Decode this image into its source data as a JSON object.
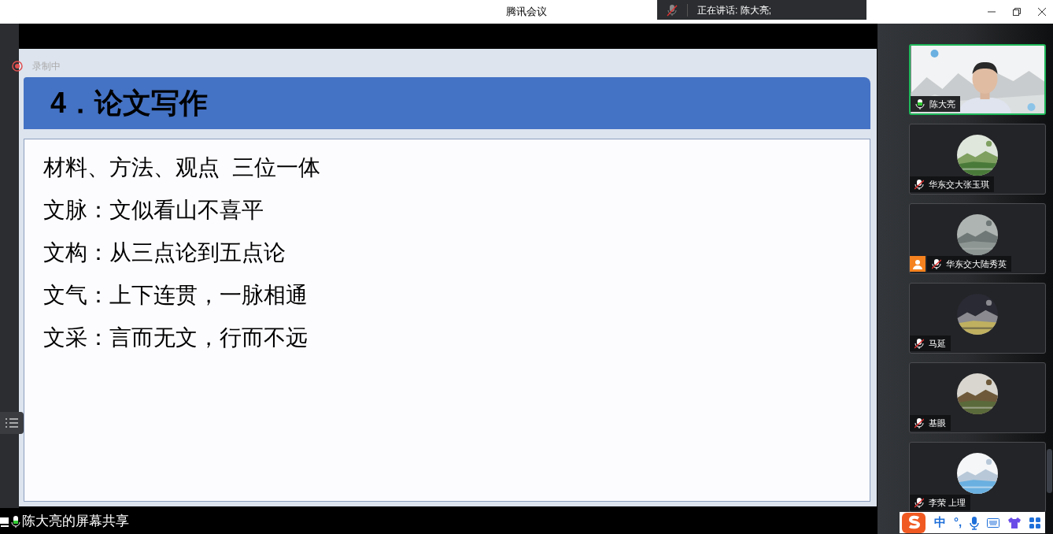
{
  "window": {
    "title": "腾讯会议"
  },
  "speaking_banner": {
    "text": "正在讲话: 陈大亮;"
  },
  "recording": {
    "text": "录制中"
  },
  "slide": {
    "title": "4．论文写作",
    "lines": [
      "材料、方法、观点  三位一体",
      "文脉：文似看山不喜平",
      "文构：从三点论到五点论",
      "文气：上下连贯，一脉相通",
      "文采：言而无文，行而不远"
    ]
  },
  "participants": [
    {
      "name": "陈大亮",
      "kind": "video",
      "muted": false,
      "speaking": true,
      "badge": false
    },
    {
      "name": "华东交大张玉琪",
      "kind": "avatar",
      "muted": true,
      "speaking": false,
      "badge": false
    },
    {
      "name": "华东交大陆秀英",
      "kind": "avatar",
      "muted": true,
      "speaking": false,
      "badge": true
    },
    {
      "name": "马延",
      "kind": "avatar",
      "muted": true,
      "speaking": false,
      "badge": false
    },
    {
      "name": "基眼",
      "kind": "avatar",
      "muted": true,
      "speaking": false,
      "badge": false
    },
    {
      "name": "李荣 上理",
      "kind": "avatar",
      "muted": true,
      "speaking": false,
      "badge": false
    }
  ],
  "share_label": {
    "text": "陈大亮的屏幕共享"
  },
  "ime_toolbar": {
    "items": [
      "中",
      "°,"
    ]
  }
}
